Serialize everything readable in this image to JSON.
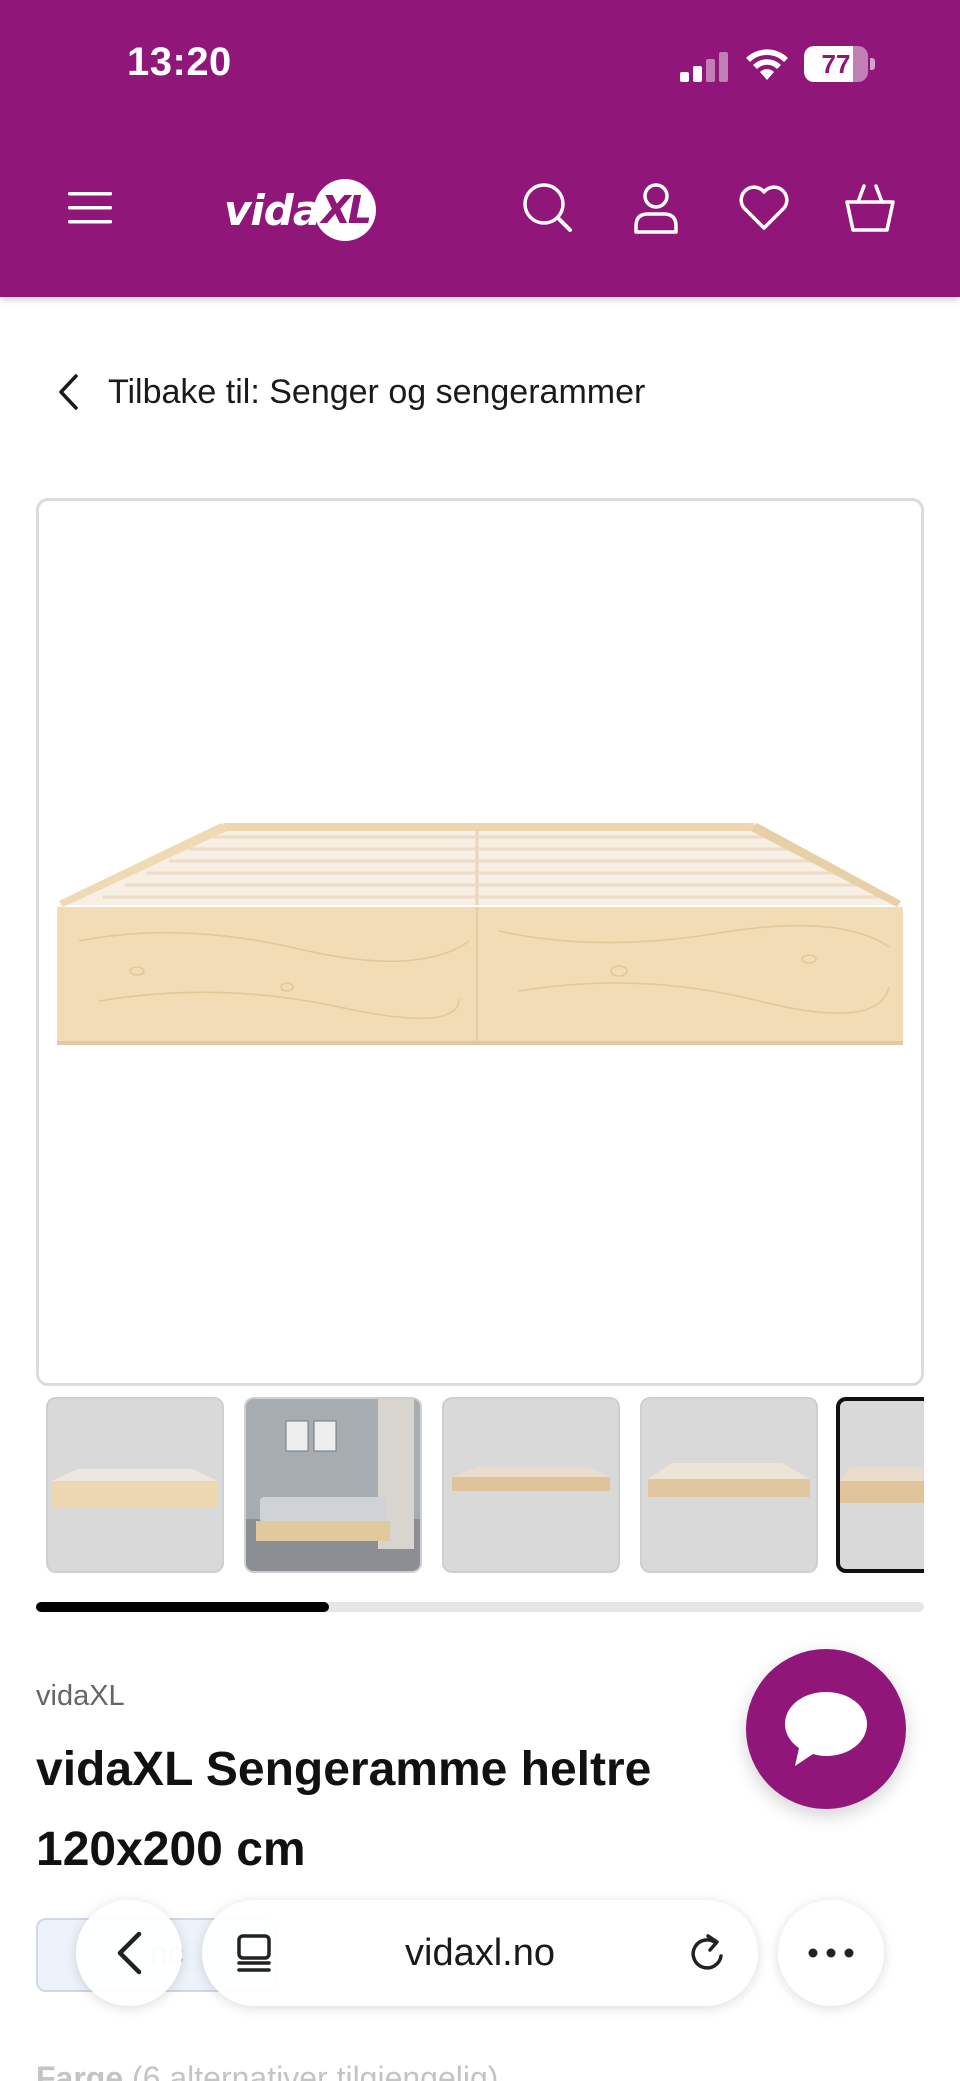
{
  "status_bar": {
    "time": "13:20",
    "battery": "77",
    "battery_level": 0.77
  },
  "header": {
    "background": "#911679",
    "logo_text": "vida",
    "logo_badge": "XL",
    "icons": [
      "menu-icon",
      "search-icon",
      "account-icon",
      "heart-icon",
      "basket-icon"
    ]
  },
  "breadcrumb": {
    "back_label": "Tilbake til: Senger og sengerammer"
  },
  "gallery": {
    "thumbnail_count": 5,
    "selected_index": 4,
    "scroll_progress": 0.33
  },
  "product": {
    "brand": "vidaXL",
    "title": "vidaXL Sengeramme heltre 120x200 cm",
    "chip_text": "nc",
    "color_label": "Farge",
    "color_options": "(6 alternativer tilgjengelig)"
  },
  "browser": {
    "url": "vidaxl.no"
  },
  "colors": {
    "brand_purple": "#911679",
    "wood": "#f1dcb5"
  }
}
